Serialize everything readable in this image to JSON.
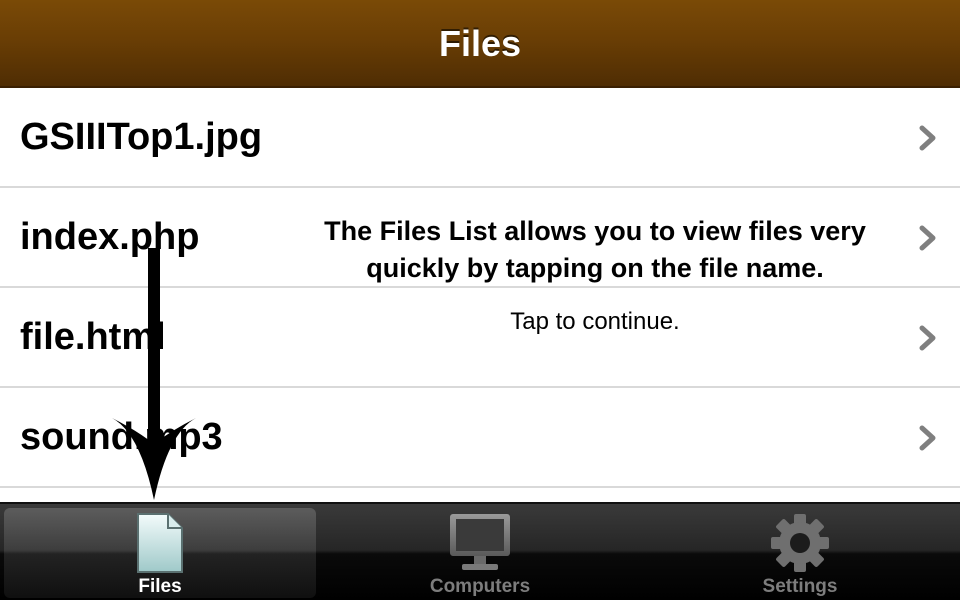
{
  "nav": {
    "title": "Files"
  },
  "files": [
    {
      "name": "GSIIITop1.jpg"
    },
    {
      "name": "index.php"
    },
    {
      "name": "file.html"
    },
    {
      "name": "sound.mp3"
    }
  ],
  "tip": {
    "message": "The Files List allows you to view files very quickly by tapping on the file name.",
    "continue": "Tap to continue."
  },
  "tabs": [
    {
      "label": "Files",
      "icon": "document-icon",
      "selected": true
    },
    {
      "label": "Computers",
      "icon": "monitor-icon",
      "selected": false
    },
    {
      "label": "Settings",
      "icon": "gear-icon",
      "selected": false
    }
  ],
  "colors": {
    "nav_bar": "#6a3e05",
    "tab_bar": "#1a1a1a",
    "selected_tab_label": "#ffffff",
    "unselected_tab_label": "#7d7d7d"
  }
}
